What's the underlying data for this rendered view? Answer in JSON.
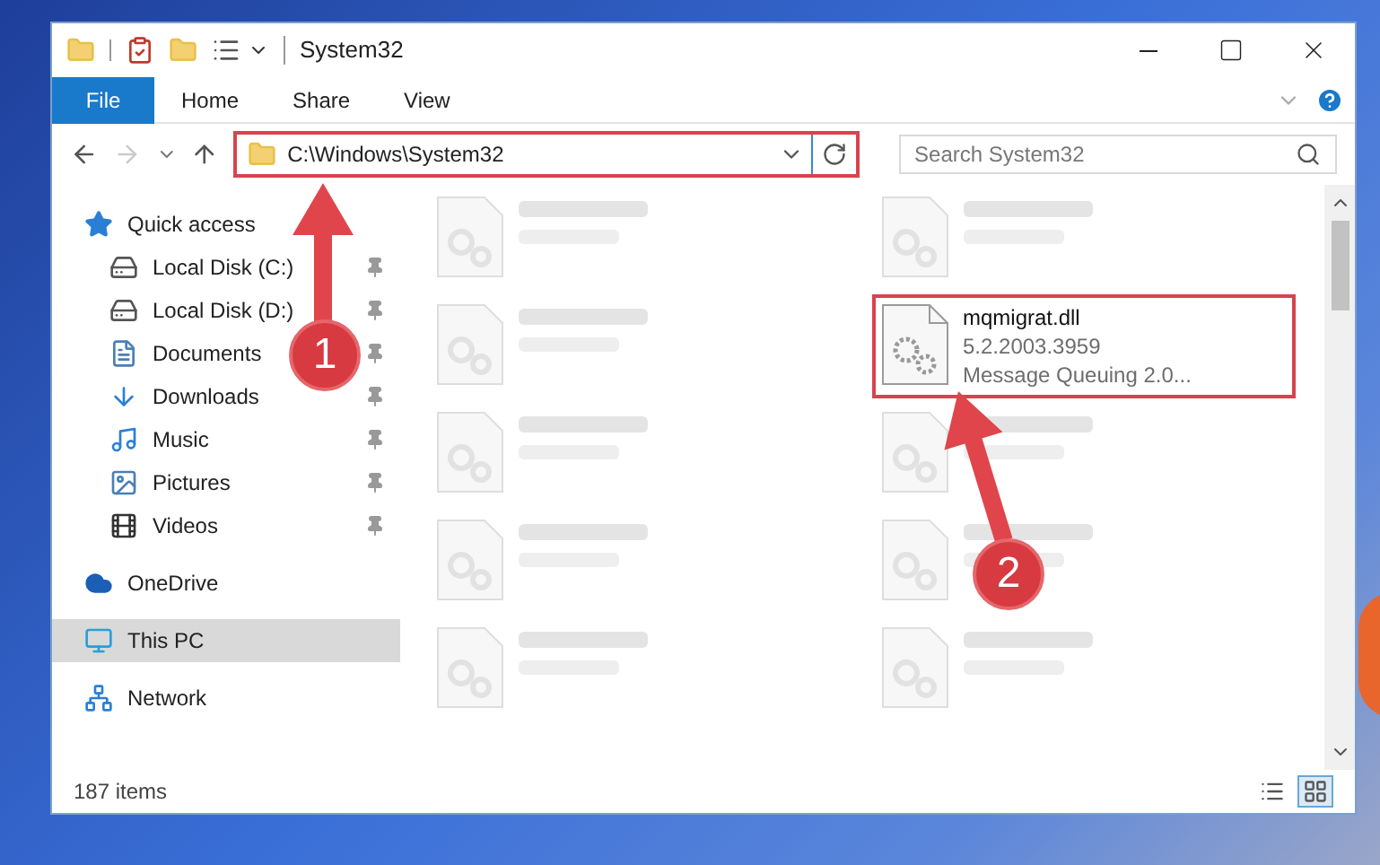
{
  "window": {
    "title": "System32"
  },
  "ribbon_tabs": [
    {
      "label": "File",
      "kind": "file"
    },
    {
      "label": "Home",
      "kind": "tab"
    },
    {
      "label": "Share",
      "kind": "tab"
    },
    {
      "label": "View",
      "kind": "tab"
    }
  ],
  "address_bar": {
    "path": "C:\\Windows\\System32",
    "highlighted": true
  },
  "search": {
    "placeholder": "Search System32"
  },
  "sidebar": {
    "items": [
      {
        "label": "Quick access",
        "kind": "star",
        "selected": false,
        "children": [
          {
            "label": "Local Disk (C:)",
            "kind": "drive-win",
            "pinned": true
          },
          {
            "label": "Local Disk (D:)",
            "kind": "drive",
            "pinned": true
          },
          {
            "label": "Documents",
            "kind": "documents",
            "pinned": true
          },
          {
            "label": "Downloads",
            "kind": "downloads",
            "pinned": true
          },
          {
            "label": "Music",
            "kind": "music",
            "pinned": true
          },
          {
            "label": "Pictures",
            "kind": "pictures",
            "pinned": true
          },
          {
            "label": "Videos",
            "kind": "videos",
            "pinned": true
          }
        ]
      },
      {
        "label": "OneDrive",
        "kind": "cloud",
        "selected": false
      },
      {
        "label": "This PC",
        "kind": "pc",
        "selected": true
      },
      {
        "label": "Network",
        "kind": "network",
        "selected": false
      }
    ]
  },
  "files": [
    {
      "kind": "blurred"
    },
    {
      "kind": "blurred"
    },
    {
      "kind": "blurred"
    },
    {
      "kind": "file",
      "name": "mqmigrat.dll",
      "lines": [
        "5.2.2003.3959",
        "Message Queuing 2.0..."
      ],
      "highlighted": true
    },
    {
      "kind": "blurred"
    },
    {
      "kind": "blurred"
    },
    {
      "kind": "blurred"
    },
    {
      "kind": "blurred"
    },
    {
      "kind": "blurred"
    },
    {
      "kind": "blurred"
    }
  ],
  "status_bar": {
    "count": "187 items",
    "views": [
      {
        "kind": "details",
        "selected": false
      },
      {
        "kind": "large-icons",
        "selected": true
      }
    ]
  },
  "annotations": [
    {
      "number": "1"
    },
    {
      "number": "2"
    }
  ]
}
